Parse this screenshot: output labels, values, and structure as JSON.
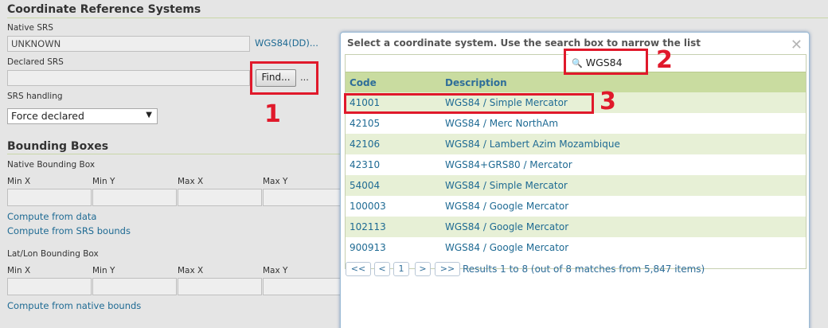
{
  "crs": {
    "title": "Coordinate Reference Systems",
    "native_srs_label": "Native SRS",
    "native_srs_value": "UNKNOWN",
    "native_srs_link": "WGS84(DD)...",
    "declared_srs_label": "Declared SRS",
    "declared_srs_value": "",
    "find_button": "Find...",
    "find_ellipsis": "...",
    "srs_handling_label": "SRS handling",
    "srs_handling_value": "Force declared"
  },
  "bbox": {
    "title": "Bounding Boxes",
    "native_label": "Native Bounding Box",
    "latlon_label": "Lat/Lon Bounding Box",
    "columns": [
      "Min X",
      "Min Y",
      "Max X",
      "Max Y"
    ],
    "compute_from_data": "Compute from data",
    "compute_from_srs": "Compute from SRS bounds",
    "compute_from_native": "Compute from native bounds"
  },
  "dialog": {
    "title": "Select a coordinate system. Use the search box to narrow the list",
    "close_icon": "close-icon",
    "search_value": "WGS84",
    "search_icon": "magnifier-icon",
    "col_code": "Code",
    "col_description": "Description",
    "rows": [
      {
        "code": "41001",
        "description": "WGS84 / Simple Mercator"
      },
      {
        "code": "42105",
        "description": "WGS84 / Merc NorthAm"
      },
      {
        "code": "42106",
        "description": "WGS84 / Lambert Azim Mozambique"
      },
      {
        "code": "42310",
        "description": "WGS84+GRS80 / Mercator"
      },
      {
        "code": "54004",
        "description": "WGS84 / Simple Mercator"
      },
      {
        "code": "100003",
        "description": "WGS84 / Google Mercator"
      },
      {
        "code": "102113",
        "description": "WGS84 / Google Mercator"
      },
      {
        "code": "900913",
        "description": "WGS84 / Google Mercator"
      }
    ],
    "pager": {
      "first": "<<",
      "prev": "<",
      "page": "1",
      "next": ">",
      "last": ">>",
      "info": "Results 1 to 8 (out of 8 matches from 5,847 items)"
    }
  },
  "annotations": {
    "step1": "1",
    "step2": "2",
    "step3": "3",
    "color": "#e0192b"
  }
}
